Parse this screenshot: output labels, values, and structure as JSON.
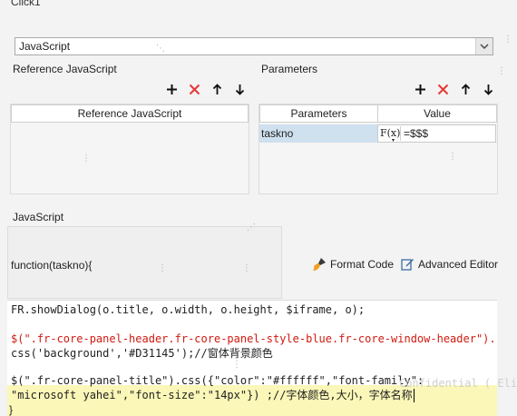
{
  "window": {
    "title": "Click1"
  },
  "type_select": {
    "value": "JavaScript"
  },
  "reference": {
    "label": "Reference JavaScript",
    "column_header": "Reference JavaScript"
  },
  "parameters": {
    "label": "Parameters",
    "columns": [
      "Parameters",
      "Value"
    ],
    "rows": [
      {
        "name": "taskno",
        "formula_label": "F(x)",
        "value": "=$$$"
      }
    ]
  },
  "javascript": {
    "label": "JavaScript",
    "signature": "function(taskno){",
    "format_code": "Format Code",
    "advanced_editor": "Advanced Editor",
    "lines": [
      "FR.showDialog(o.title, o.width, o.height, $iframe, o);",
      "",
      "$(\".fr-core-panel-header.fr-core-panel-style-blue.fr-core-window-header\").",
      "css('background','#D31145');//窗体背景颜色",
      "",
      "$(\".fr-core-panel-title\").css({\"color\":\"#ffffff\",\"font-family\":",
      "\"microsoft yahei\",\"font-size\":\"14px\"}) ;//字体颜色,大小，字体名称"
    ],
    "closing": "}"
  },
  "toolbar_icons": [
    "plus-icon",
    "close-x-icon",
    "arrow-up-icon",
    "arrow-down-icon"
  ],
  "watermark": "Confidential ( Eli",
  "colors": {
    "remove": "#e53935",
    "selected_row": "#cfe0ee",
    "highlight": "#fbf7b8"
  }
}
